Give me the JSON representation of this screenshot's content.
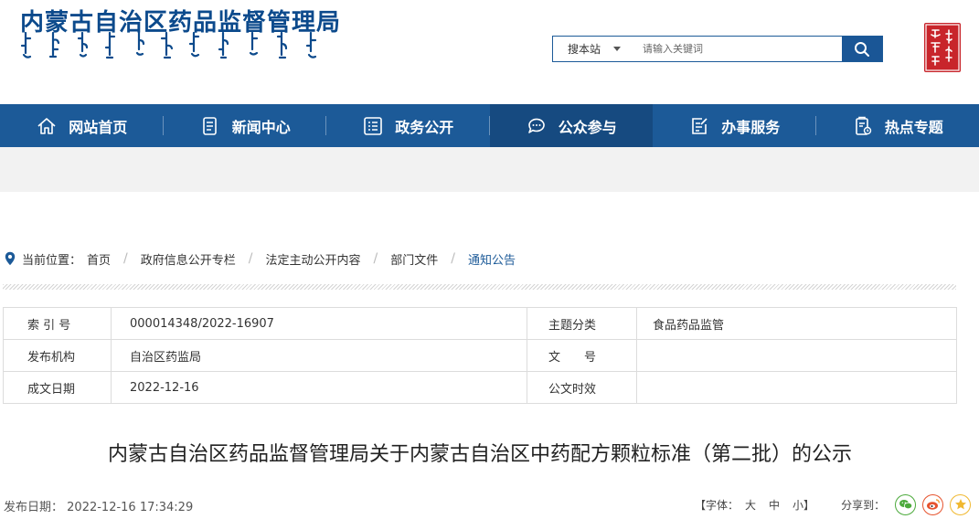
{
  "site": {
    "title": "内蒙古自治区药品监督管理局",
    "seal_text": "内蒙古",
    "seal_color": "#c8252b"
  },
  "search": {
    "scope_label": "搜本站",
    "placeholder": "请输入关键词"
  },
  "nav": [
    {
      "label": "网站首页",
      "icon": "home-icon"
    },
    {
      "label": "新闻中心",
      "icon": "document-icon"
    },
    {
      "label": "政务公开",
      "icon": "list-icon"
    },
    {
      "label": "公众参与",
      "icon": "chat-icon",
      "active": true
    },
    {
      "label": "办事服务",
      "icon": "edit-icon"
    },
    {
      "label": "热点专题",
      "icon": "clipboard-icon"
    }
  ],
  "breadcrumb": {
    "label": "当前位置：",
    "items": [
      "首页",
      "政府信息公开专栏",
      "法定主动公开内容",
      "部门文件",
      "通知公告"
    ]
  },
  "info_table": {
    "rows": [
      {
        "k1": "索 引 号",
        "v1": "000014348/2022-16907",
        "k2": "主题分类",
        "v2": "食品药品监管"
      },
      {
        "k1": "发布机构",
        "v1": "自治区药监局",
        "k2": "文　　号",
        "v2": ""
      },
      {
        "k1": "成文日期",
        "v1": "2022-12-16",
        "k2": "公文时效",
        "v2": ""
      }
    ]
  },
  "article": {
    "title": "内蒙古自治区药品监督管理局关于内蒙古自治区中药配方颗粒标准（第二批）的公示",
    "pub_label": "发布日期：",
    "pub_date": "2022-12-16 17:34:29"
  },
  "toolbar": {
    "font_label": "【字体：",
    "font_large": "大",
    "font_medium": "中",
    "font_small": "小】",
    "share_label": "分享到：",
    "share_icons": [
      "wechat-icon",
      "weibo-icon",
      "favorite-icon"
    ]
  },
  "colors": {
    "brand_blue": "#1c5a98",
    "nav_active": "#164a80",
    "band_gray": "#f2f2f2"
  }
}
